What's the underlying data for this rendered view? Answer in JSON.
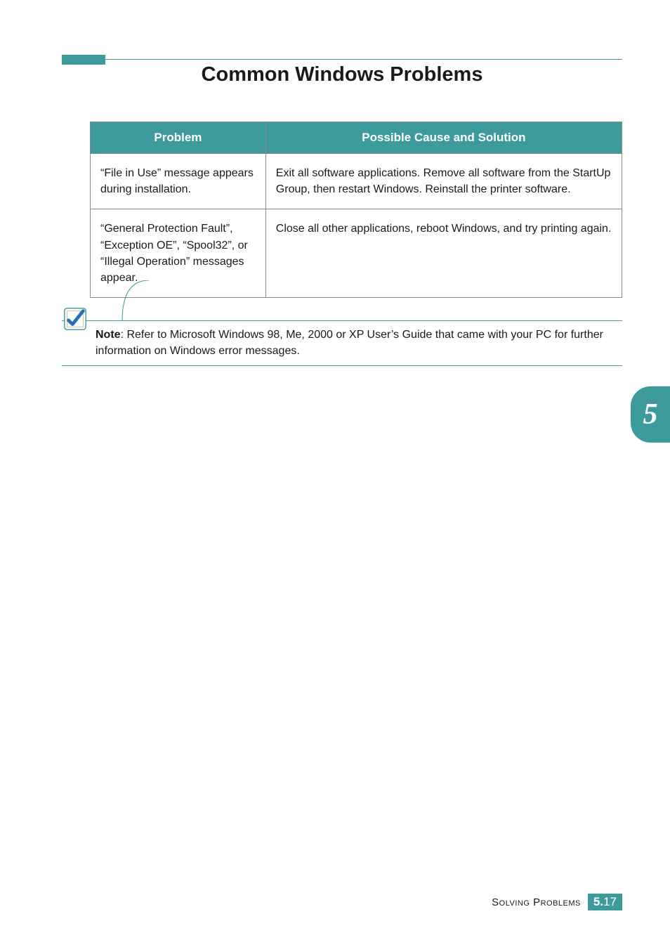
{
  "title": "Common Windows Problems",
  "table": {
    "headers": [
      "Problem",
      "Possible Cause and Solution"
    ],
    "rows": [
      {
        "problem": "“File in Use” message appears during installation.",
        "solution": "Exit all software applications. Remove all software from the StartUp Group, then restart Windows. Reinstall the printer software."
      },
      {
        "problem": "“General Protection Fault”, “Exception OE”, “Spool32”, or “Illegal Operation” messages appear.",
        "solution": "Close all other applications, reboot Windows, and try printing again."
      }
    ]
  },
  "note": {
    "bold": "Note",
    "text": ": Refer to Microsoft Windows 98, Me, 2000 or XP User’s Guide that came with your PC for further information on Windows error messages."
  },
  "chapter": "5",
  "footer": {
    "label": "Solving Problems",
    "chapter": "5.",
    "page": "17"
  }
}
